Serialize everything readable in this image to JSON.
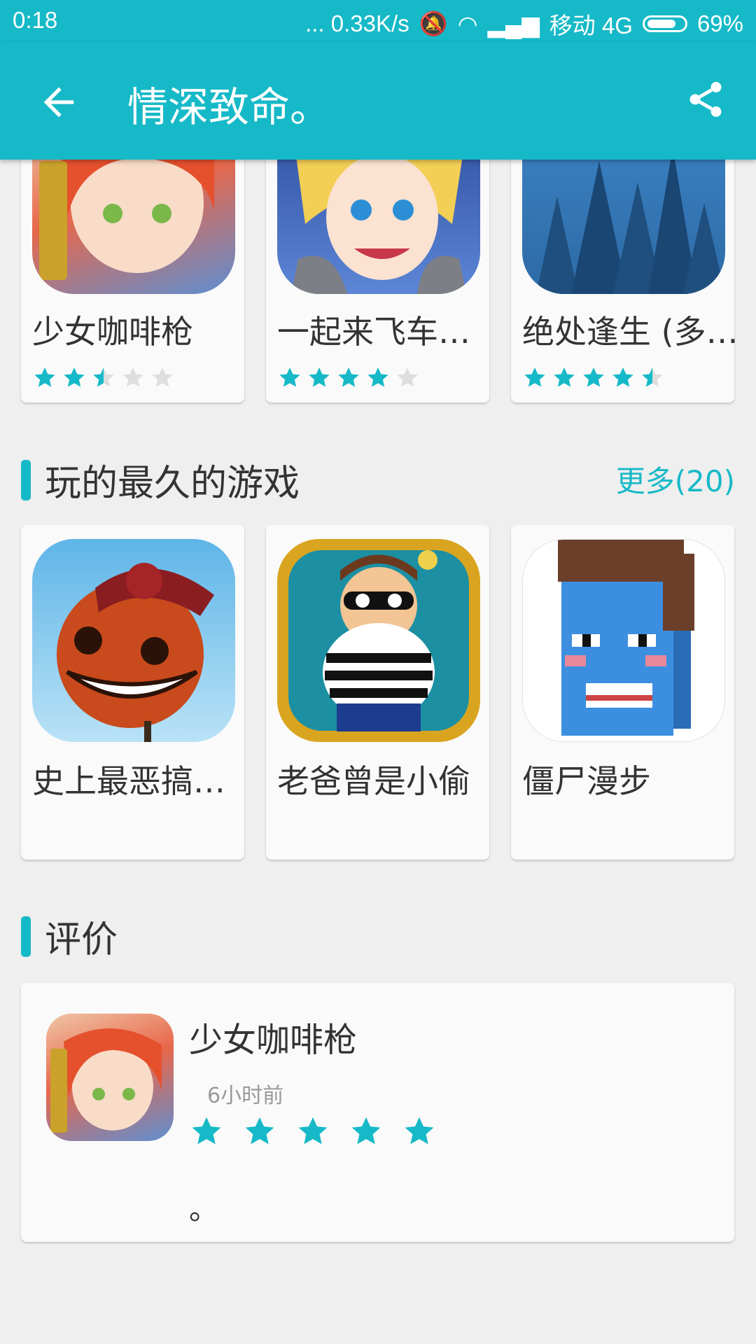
{
  "status_bar": {
    "time": "0:18",
    "network_speed": "... 0.33K/s",
    "carrier": "移动 4G",
    "battery": "69%"
  },
  "app_bar": {
    "title": "情深致命。",
    "back_icon": "arrow-left-icon",
    "share_icon": "share-icon"
  },
  "top_games": [
    {
      "name": "少女咖啡枪",
      "rating": 2.5
    },
    {
      "name": "一起来飞车…",
      "rating": 4
    },
    {
      "name": "绝处逢生 (多…",
      "rating": 4.5
    }
  ],
  "longest_played": {
    "title": "玩的最久的游戏",
    "more": "更多(20)",
    "games": [
      {
        "name": "史上最恶搞…"
      },
      {
        "name": "老爸曾是小偷"
      },
      {
        "name": "僵尸漫步"
      }
    ]
  },
  "reviews": {
    "title": "评价",
    "items": [
      {
        "game": "少女咖啡枪",
        "time": "6小时前",
        "rating": 5,
        "text": "。"
      }
    ]
  },
  "colors": {
    "accent": "#16b9c7",
    "star_off": "#dedede"
  }
}
